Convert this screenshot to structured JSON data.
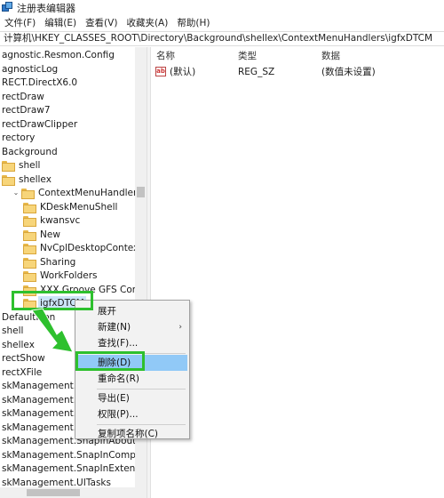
{
  "window": {
    "title": "注册表编辑器"
  },
  "menubar": [
    "文件(F)",
    "编辑(E)",
    "查看(V)",
    "收藏夹(A)",
    "帮助(H)"
  ],
  "address": "计算机\\HKEY_CLASSES_ROOT\\Directory\\Background\\shellex\\ContextMenuHandlers\\igfxDTCM",
  "tree": [
    {
      "label": "agnostic.Resmon.Config",
      "indent": 0,
      "folder": false,
      "expander": ""
    },
    {
      "label": "agnosticLog",
      "indent": 0,
      "folder": false,
      "expander": ""
    },
    {
      "label": "RECT.DirectX6.0",
      "indent": 0,
      "folder": false,
      "expander": ""
    },
    {
      "label": "rectDraw",
      "indent": 0,
      "folder": false,
      "expander": ""
    },
    {
      "label": "rectDraw7",
      "indent": 0,
      "folder": false,
      "expander": ""
    },
    {
      "label": "rectDrawClipper",
      "indent": 0,
      "folder": false,
      "expander": ""
    },
    {
      "label": "rectory",
      "indent": 0,
      "folder": false,
      "expander": ""
    },
    {
      "label": "Background",
      "indent": 0,
      "folder": false,
      "expander": ""
    },
    {
      "label": "shell",
      "indent": 1,
      "folder": true,
      "expander": ""
    },
    {
      "label": "shellex",
      "indent": 1,
      "folder": true,
      "expander": ""
    },
    {
      "label": "ContextMenuHandlers",
      "indent": 2,
      "folder": true,
      "expander": "⌄"
    },
    {
      "label": "KDeskMenuShell",
      "indent": 3,
      "folder": true,
      "expander": ""
    },
    {
      "label": "kwansvc",
      "indent": 3,
      "folder": true,
      "expander": ""
    },
    {
      "label": "New",
      "indent": 3,
      "folder": true,
      "expander": ""
    },
    {
      "label": "NvCplDesktopContext",
      "indent": 3,
      "folder": true,
      "expander": ""
    },
    {
      "label": "Sharing",
      "indent": 3,
      "folder": true,
      "expander": ""
    },
    {
      "label": "WorkFolders",
      "indent": 3,
      "folder": true,
      "expander": ""
    },
    {
      "label": "XXX Groove GFS Context",
      "indent": 3,
      "folder": true,
      "expander": ""
    },
    {
      "label": "igfxDTCM",
      "indent": 3,
      "folder": true,
      "expander": "",
      "selected": true
    },
    {
      "label": "DefaultIcon",
      "indent": 0,
      "folder": false,
      "expander": ""
    },
    {
      "label": "shell",
      "indent": 0,
      "folder": false,
      "expander": ""
    },
    {
      "label": "shellex",
      "indent": 0,
      "folder": false,
      "expander": ""
    },
    {
      "label": "rectShow",
      "indent": 0,
      "folder": false,
      "expander": ""
    },
    {
      "label": "rectXFile",
      "indent": 0,
      "folder": false,
      "expander": ""
    },
    {
      "label": "skManagement.Co",
      "indent": 0,
      "folder": false,
      "expander": ""
    },
    {
      "label": "skManagement.Co",
      "indent": 0,
      "folder": false,
      "expander": ""
    },
    {
      "label": "skManagement.Da",
      "indent": 0,
      "folder": false,
      "expander": ""
    },
    {
      "label": "skManagement.Sna",
      "indent": 0,
      "folder": false,
      "expander": ""
    },
    {
      "label": "skManagement.SnapInAbout",
      "indent": 0,
      "folder": false,
      "expander": ""
    },
    {
      "label": "skManagement.SnapInComponen",
      "indent": 0,
      "folder": false,
      "expander": ""
    },
    {
      "label": "skManagement.SnapInExtension",
      "indent": 0,
      "folder": false,
      "expander": ""
    },
    {
      "label": "skManagement.UITasks",
      "indent": 0,
      "folder": false,
      "expander": ""
    }
  ],
  "values_pane": {
    "columns": [
      "名称",
      "类型",
      "数据"
    ],
    "rows": [
      {
        "icon": "ab",
        "name": "(默认)",
        "type": "REG_SZ",
        "data": "(数值未设置)"
      }
    ]
  },
  "context_menu": {
    "items": [
      {
        "label": "展开",
        "submenu": false
      },
      {
        "label": "新建(N)",
        "submenu": true,
        "arrow": "›"
      },
      {
        "label": "查找(F)...",
        "submenu": false
      },
      {
        "label": "删除(D)",
        "submenu": false,
        "highlight": true
      },
      {
        "label": "重命名(R)",
        "submenu": false
      },
      {
        "label": "导出(E)",
        "submenu": false
      },
      {
        "label": "权限(P)...",
        "submenu": false
      },
      {
        "label": "复制项名称(C)",
        "submenu": false
      }
    ]
  },
  "colors": {
    "annotation": "#2ec02e",
    "menu_highlight": "#91c9f7",
    "selection": "#cce4f7"
  }
}
